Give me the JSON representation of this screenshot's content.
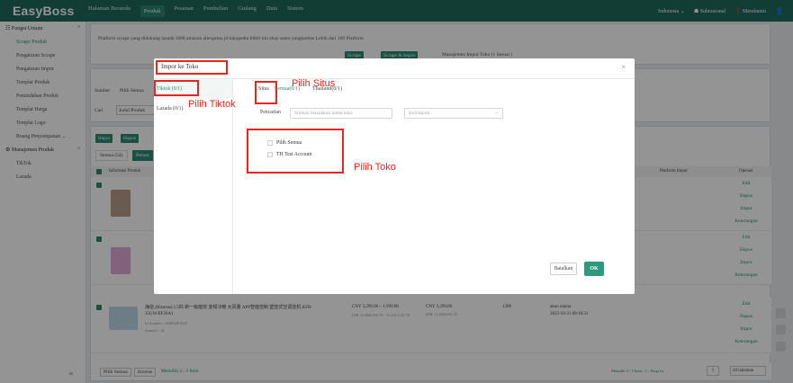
{
  "app": {
    "logo": "EasyBoss",
    "nav": [
      "Halaman Beranda",
      "Produk",
      "Pesanan",
      "Pembelian",
      "Gudang",
      "Data",
      "Sistem"
    ],
    "active_nav": "Produk",
    "top_right": {
      "language": "Indonesia",
      "sub_account": "Subrasional",
      "help": "Membantu",
      "user_icon": "user-icon"
    }
  },
  "sidebar": {
    "group1": "Fungsi Umum",
    "items1": [
      "Scrape Produk",
      "Pengaturan Scrape",
      "Pengaturan Impor",
      "Templat Produk",
      "Pemindahan Produk",
      "Templat Harga",
      "Templat Logo",
      "Ruang Penyampanan ..."
    ],
    "group2": "Manajemen Produk",
    "items2": [
      "TikTok",
      "Lazada"
    ]
  },
  "background": {
    "info_text": "Platform scrape yang didukung lazada  1688  amazon  aliexpress  jd  tokopedia  blibli  tiki  ebay  sento  yangtaobao Lebih dari 100 Platform",
    "scrape_btn": "Scrape",
    "scrape_import_btn": "Scrape & Impor",
    "manage_link": "Manajemen Impor Toko (1 Sesuai )",
    "sumber_label": "Sumber",
    "pilih_semua": "Pilih Semua",
    "cari_label": "Cari",
    "cari_select": "Judul Produk",
    "btn_impor": "Impor",
    "btn_hapus": "Hapus",
    "tab_semua": "Semua (54)",
    "tab_belum": "Belum",
    "col_info": "Informasi Produk",
    "col_platform": "Platform Impor",
    "col_operasi": "Operasi",
    "ops": [
      "Edit",
      "Hapus",
      "Impor",
      "Keterangan"
    ],
    "row3": {
      "title": "海信 (Hisense) 1.5匹 新一级能效 变频冷暖 大风量 APP智能控制 壁挂式空调挂机 KFR-35GW/EF20A1",
      "id": "Id Sumber : 10003481943",
      "source": "Sumber : jd",
      "price1": "CNY 3,299.00 ~ 1,999.00",
      "price1_idr": "IDR 11,468,655.70 ~ 6,510.6 55.70",
      "price2": "CNY 3,299.00",
      "price2_idr": "IDR 11,468,655.70",
      "stock": "1200",
      "status": "akun utama",
      "date": "2022-10-31 09:18:31"
    },
    "footer": {
      "pilih_semua": "Pilih Semua",
      "inverse": "Inverse",
      "memilih": "Memilih 3 / 3 Item",
      "pagination": "Memilih 3 / 3 Item  ‹ 1 ›  Pergi ke",
      "page_input": "1",
      "per_page": "20 halaman"
    }
  },
  "modal": {
    "title": "Impor ke Toko",
    "close": "×",
    "platforms": [
      "Tiktok (0/1)",
      "Lazada (0/1)"
    ],
    "site_label": "Situs",
    "site_tabs": [
      "Semua(0/1)",
      "Thailand(0/1)"
    ],
    "search_label": "Pencarian",
    "search_placeholder": "Silakan masukkan nama toko",
    "group_placeholder": "Kelompok",
    "select_all": "Pilih Semua",
    "shops": [
      "TH Test Account"
    ],
    "cancel": "Batalkan",
    "ok": "OK"
  },
  "annotations": {
    "pilih_situs": "Pilih Situs",
    "pilih_tiktok": "Pilih Tiktok",
    "pilih_toko": "Pilih Toko"
  }
}
